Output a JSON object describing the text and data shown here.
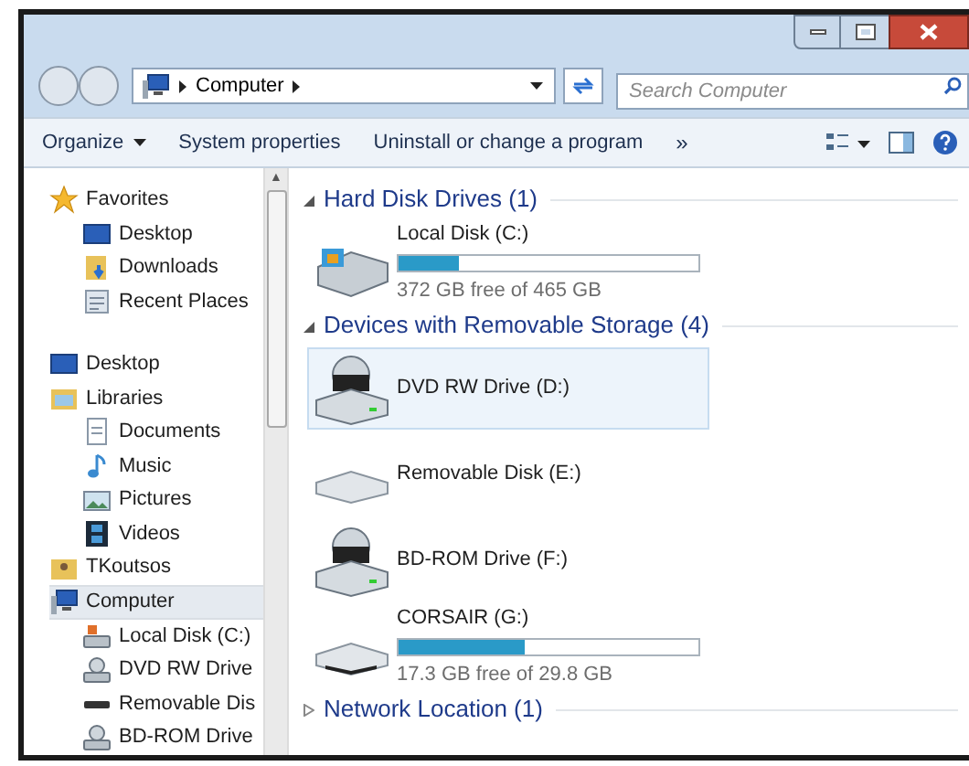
{
  "address_bar": {
    "path": [
      "Computer"
    ]
  },
  "search": {
    "placeholder": "Search Computer"
  },
  "toolbar": [
    {
      "label": "Organize",
      "dropdown": true
    },
    {
      "label": "System properties",
      "dropdown": false
    },
    {
      "label": "Uninstall or change a program",
      "dropdown": false
    }
  ],
  "toolbar_more": "»",
  "scroll_up": "▲",
  "sidebar": {
    "items": [
      {
        "label": "Favorites",
        "kind": "star",
        "selected": false,
        "children": [
          {
            "label": "Desktop",
            "kind": "desktop",
            "selected": false
          },
          {
            "label": "Downloads",
            "kind": "download",
            "selected": false
          },
          {
            "label": "Recent Places",
            "kind": "recent",
            "selected": false
          }
        ]
      },
      {
        "label": "Desktop",
        "kind": "desktop",
        "selected": false,
        "children": [
          {
            "label": "Libraries",
            "kind": "library",
            "selected": false,
            "children": [
              {
                "label": "Documents",
                "kind": "document",
                "selected": false
              },
              {
                "label": "Music",
                "kind": "music",
                "selected": false
              },
              {
                "label": "Pictures",
                "kind": "picture",
                "selected": false
              },
              {
                "label": "Videos",
                "kind": "video",
                "selected": false
              }
            ]
          },
          {
            "label": "TKoutsos",
            "kind": "user",
            "selected": false
          },
          {
            "label": "Computer",
            "kind": "computer",
            "selected": true,
            "children": [
              {
                "label": "Local Disk (C:)",
                "kind": "hdd",
                "selected": false
              },
              {
                "label": "DVD RW Drive",
                "kind": "optical",
                "selected": false
              },
              {
                "label": "Removable Dis",
                "kind": "usb",
                "selected": false
              },
              {
                "label": "BD-ROM Drive",
                "kind": "optical",
                "selected": false
              }
            ]
          }
        ]
      }
    ]
  },
  "groups": [
    {
      "title": "Hard Disk Drives (1)",
      "expanded": true,
      "drives": [
        {
          "name": "Local Disk (C:)",
          "kind": "hdd",
          "selected": false,
          "level": 0.2,
          "free": "372 GB free of 465 GB"
        }
      ]
    },
    {
      "title": "Devices with Removable Storage (4)",
      "expanded": true,
      "drives": [
        {
          "name": "DVD RW Drive (D:)",
          "kind": "dvd",
          "selected": true
        },
        {
          "name": "Removable Disk (E:)",
          "kind": "removable",
          "selected": false
        },
        {
          "name": "BD-ROM Drive (F:)",
          "kind": "bd",
          "selected": false
        },
        {
          "name": "CORSAIR (G:)",
          "kind": "usb",
          "selected": false,
          "level": 0.42,
          "free": "17.3 GB free of 29.8 GB"
        }
      ]
    },
    {
      "title": "Network Location (1)",
      "expanded": false
    }
  ]
}
